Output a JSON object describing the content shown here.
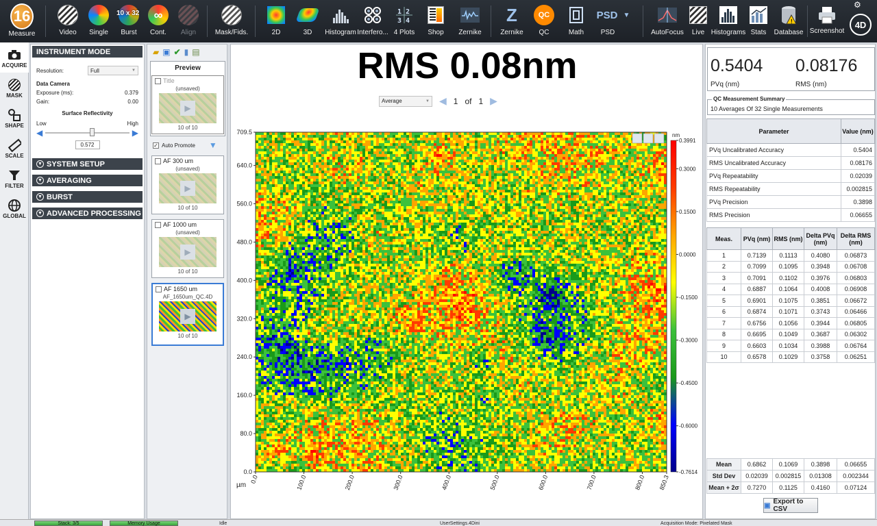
{
  "toolbar": {
    "measure": {
      "badge": "16",
      "label": "Measure"
    },
    "video": "Video",
    "single": "Single",
    "burst": {
      "label": "Burst",
      "badge": "10 x 32"
    },
    "cont": "Cont.",
    "align": "Align",
    "mask_fids": "Mask/Fids.",
    "plot_2d": "2D",
    "plot_3d": "3D",
    "histogram": "Histogram",
    "interferogram": "Interfero...",
    "four_plots": "4 Plots",
    "shop": "Shop",
    "zernike_plot": "Zernike",
    "zernike": {
      "label": "Zernike",
      "glyph": "Z"
    },
    "qc": {
      "label": "QC",
      "glyph": "QC"
    },
    "math": "Math",
    "psd": {
      "label": "PSD",
      "glyph": "PSD"
    },
    "autofocus": "AutoFocus",
    "live": "Live",
    "histograms": "Histograms",
    "stats": "Stats",
    "database": "Database",
    "screenshot": "Screenshot",
    "logo": "4D"
  },
  "rail": {
    "acquire": "ACQUIRE",
    "mask": "MASK",
    "shape": "SHAPE",
    "scale": "SCALE",
    "filter": "FILTER",
    "global": "GLOBAL"
  },
  "settings": {
    "instrument_mode": "INSTRUMENT MODE",
    "resolution_label": "Resolution:",
    "resolution_value": "Full",
    "data_camera": "Data Camera",
    "exposure_label": "Exposure (ms):",
    "exposure_value": "0.379",
    "gain_label": "Gain:",
    "gain_value": "0.00",
    "surface_reflectivity": "Surface Reflectivity",
    "low": "Low",
    "high": "High",
    "reflectivity_value": "0.572",
    "reflectivity_level": 0.55,
    "system_setup": "SYSTEM SETUP",
    "averaging": "AVERAGING",
    "burst": "BURST",
    "advanced_processing": "ADVANCED PROCESSING"
  },
  "preview": {
    "header": "Preview",
    "auto_promote": "Auto Promote",
    "cards": [
      {
        "title": "Title",
        "sub": "(unsaved)",
        "count": "10 of 10"
      },
      {
        "title": "AF 300 um",
        "sub": "(unsaved)",
        "count": "10 of 10"
      },
      {
        "title": "AF 1000 um",
        "sub": "(unsaved)",
        "count": "10 of 10"
      },
      {
        "title": "AF 1650 um",
        "sub": "AF_1650um_QC.4D",
        "count": "10 of 10"
      }
    ]
  },
  "main": {
    "headline": "RMS 0.08nm",
    "view_select": "Average",
    "page_current": "1",
    "page_of": "of",
    "page_total": "1"
  },
  "chart_data": {
    "type": "heatmap",
    "xlabel": "µm",
    "x_ticks": [
      "0.0",
      "100.0",
      "200.0",
      "300.0",
      "400.0",
      "500.0",
      "600.0",
      "700.0",
      "800.0",
      "850.3"
    ],
    "x_tick_values": [
      0,
      100,
      200,
      300,
      400,
      500,
      600,
      700,
      800,
      850.3
    ],
    "y_ticks": [
      "0.0",
      "80.0",
      "160.0",
      "240.0",
      "320.0",
      "400.0",
      "480.0",
      "560.0",
      "640.0",
      "709.5"
    ],
    "y_tick_values": [
      0,
      80,
      160,
      240,
      320,
      400,
      480,
      560,
      640,
      709.5
    ],
    "xlim": [
      0,
      850.3
    ],
    "ylim": [
      0,
      709.5
    ],
    "colorbar_unit": "nm",
    "colorbar_ticks": [
      "0.3991",
      "0.3000",
      "0.1500",
      "0.0000",
      "-0.1500",
      "-0.3000",
      "-0.4500",
      "-0.6000",
      "-0.7614"
    ],
    "colorbar_values": [
      0.3991,
      0.3,
      0.15,
      0.0,
      -0.15,
      -0.3,
      -0.45,
      -0.6,
      -0.7614
    ],
    "zlim": [
      -0.7614,
      0.3991
    ],
    "colors": [
      "#00008b",
      "#0000ff",
      "#1a9a1a",
      "#3cc13c",
      "#ffff00",
      "#ffa500",
      "#ff3b00",
      "#ff0000"
    ]
  },
  "results": {
    "pvq_value": "0.5404",
    "pvq_unit": "PVq (nm)",
    "rms_value": "0.08176",
    "rms_unit": "RMS (nm)",
    "summary_title": "QC Measurement Summary",
    "summary_text": "10 Averages Of 32 Single Measurements",
    "param_headers": [
      "Parameter",
      "Value (nm)"
    ],
    "params": [
      {
        "name": "PVq Uncalibrated Accuracy",
        "value": "0.5404"
      },
      {
        "name": "RMS Uncalibrated Accuracy",
        "value": "0.08176"
      },
      {
        "name": "PVq Repeatability",
        "value": "0.02039"
      },
      {
        "name": "RMS Repeatability",
        "value": "0.002815"
      },
      {
        "name": "PVq Precision",
        "value": "0.3898"
      },
      {
        "name": "RMS Precision",
        "value": "0.06655"
      }
    ],
    "meas_headers": [
      "Meas.",
      "PVq (nm)",
      "RMS (nm)",
      "Delta PVq (nm)",
      "Delta RMS (nm)"
    ],
    "measurements": [
      [
        "1",
        "0.7139",
        "0.1113",
        "0.4080",
        "0.06873"
      ],
      [
        "2",
        "0.7099",
        "0.1095",
        "0.3948",
        "0.06708"
      ],
      [
        "3",
        "0.7091",
        "0.1102",
        "0.3976",
        "0.06803"
      ],
      [
        "4",
        "0.6887",
        "0.1064",
        "0.4008",
        "0.06908"
      ],
      [
        "5",
        "0.6901",
        "0.1075",
        "0.3851",
        "0.06672"
      ],
      [
        "6",
        "0.6874",
        "0.1071",
        "0.3743",
        "0.06466"
      ],
      [
        "7",
        "0.6756",
        "0.1056",
        "0.3944",
        "0.06805"
      ],
      [
        "8",
        "0.6695",
        "0.1049",
        "0.3687",
        "0.06302"
      ],
      [
        "9",
        "0.6603",
        "0.1034",
        "0.3988",
        "0.06764"
      ],
      [
        "10",
        "0.6578",
        "0.1029",
        "0.3758",
        "0.06251"
      ]
    ],
    "stats": [
      [
        "Mean",
        "0.6862",
        "0.1069",
        "0.3898",
        "0.06655"
      ],
      [
        "Std Dev",
        "0.02039",
        "0.002815",
        "0.01308",
        "0.002344"
      ],
      [
        "Mean + 2σ",
        "0.7270",
        "0.1125",
        "0.4160",
        "0.07124"
      ]
    ],
    "export": "Export to CSV"
  },
  "status": {
    "stack": "Stack: 3/5",
    "memory": "Memory Usage",
    "state": "Idle",
    "settings_file": "UserSettings.4Dini",
    "acq_mode": "Acquisition Mode: Pixelated Mask"
  }
}
